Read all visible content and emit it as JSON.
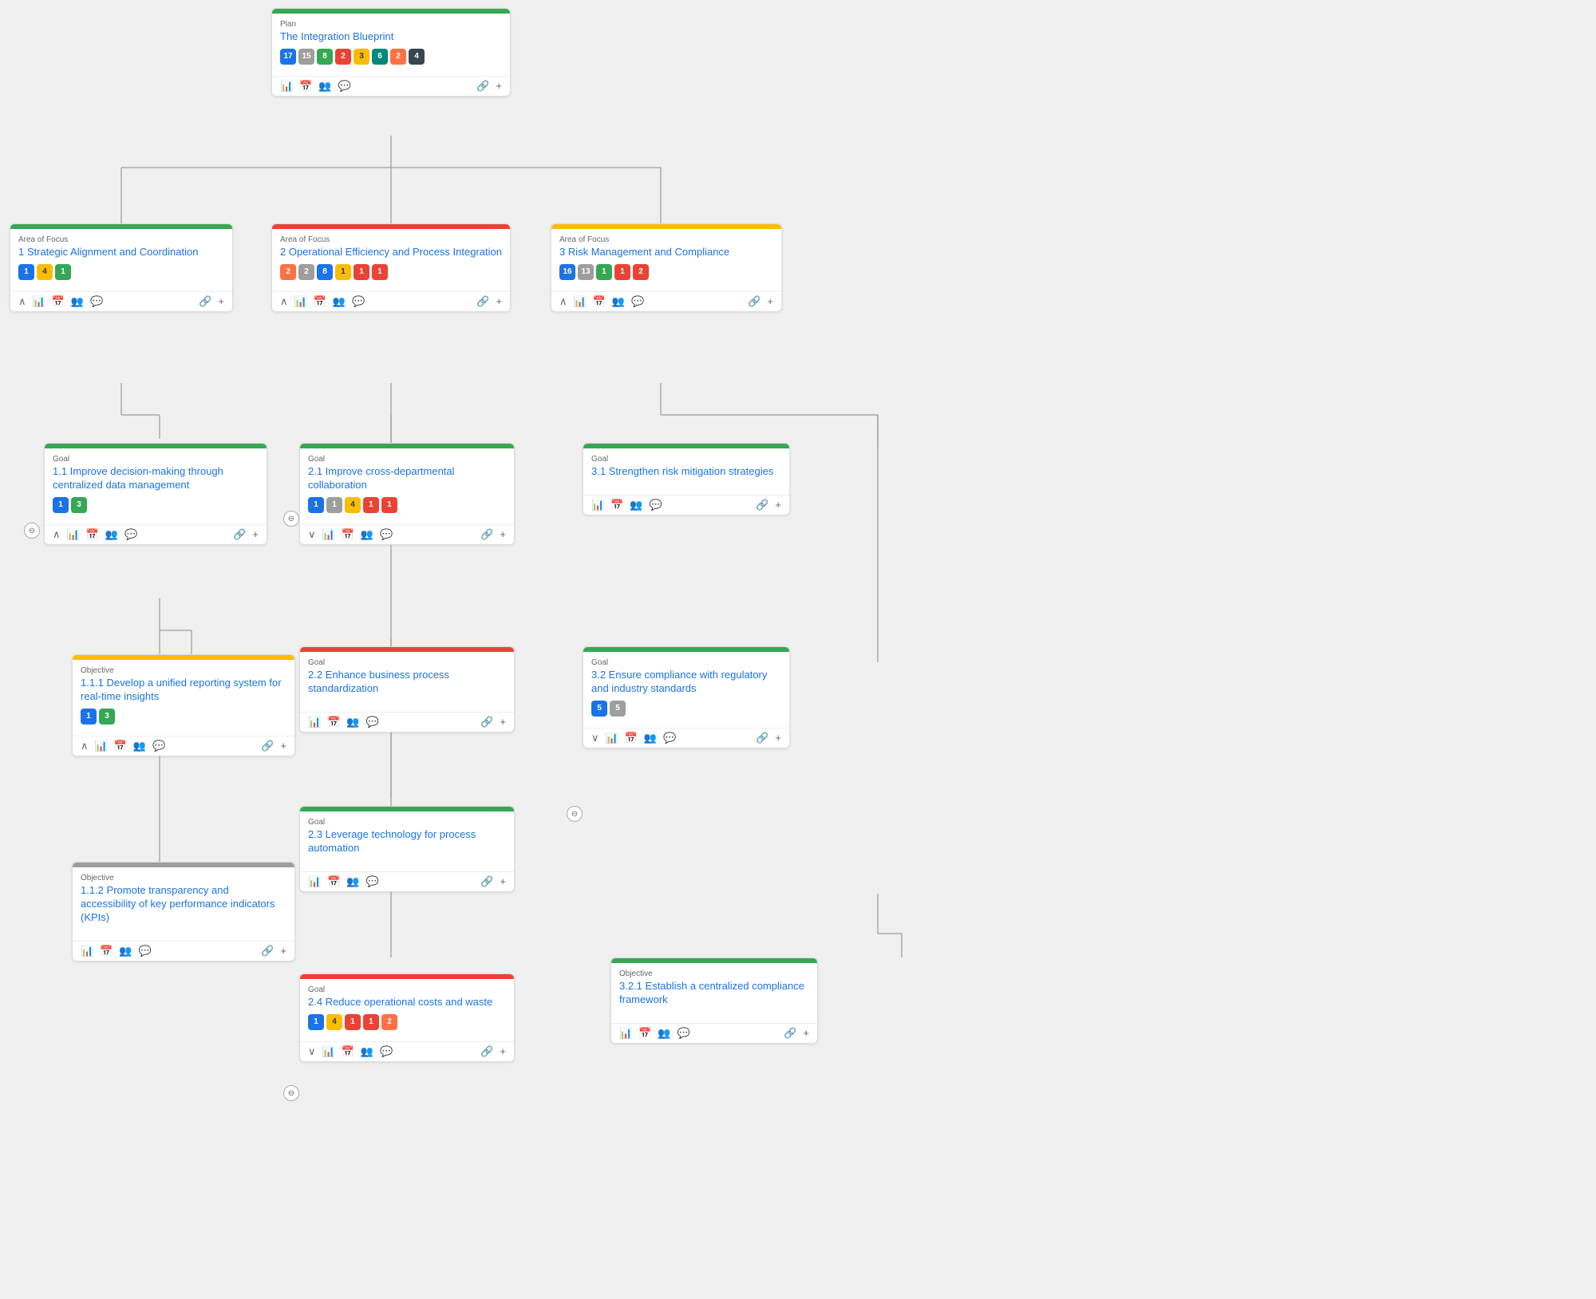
{
  "plan": {
    "type": "Plan",
    "title": "The Integration Blueprint",
    "badges": [
      {
        "value": "17",
        "color": "blue"
      },
      {
        "value": "15",
        "color": "gray"
      },
      {
        "value": "8",
        "color": "green"
      },
      {
        "value": "2",
        "color": "red"
      },
      {
        "value": "3",
        "color": "yellow"
      },
      {
        "value": "6",
        "color": "teal"
      },
      {
        "value": "2",
        "color": "orange"
      },
      {
        "value": "4",
        "color": "dark"
      }
    ],
    "header_color": "green"
  },
  "areas": [
    {
      "type": "Area of Focus",
      "number": "1",
      "title": "Strategic Alignment and Coordination",
      "badges": [
        {
          "value": "1",
          "color": "blue"
        },
        {
          "value": "4",
          "color": "yellow"
        },
        {
          "value": "1",
          "color": "green"
        }
      ],
      "header_color": "green"
    },
    {
      "type": "Area of Focus",
      "number": "2",
      "title": "Operational Efficiency and Process Integration",
      "badges": [
        {
          "value": "2",
          "color": "orange"
        },
        {
          "value": "2",
          "color": "gray"
        },
        {
          "value": "8",
          "color": "blue"
        },
        {
          "value": "1",
          "color": "yellow"
        },
        {
          "value": "1",
          "color": "red"
        },
        {
          "value": "1",
          "color": "red"
        }
      ],
      "header_color": "red"
    },
    {
      "type": "Area of Focus",
      "number": "3",
      "title": "Risk Management and Compliance",
      "badges": [
        {
          "value": "16",
          "color": "blue"
        },
        {
          "value": "13",
          "color": "gray"
        },
        {
          "value": "1",
          "color": "green"
        },
        {
          "value": "1",
          "color": "red"
        },
        {
          "value": "2",
          "color": "red"
        }
      ],
      "header_color": "yellow"
    }
  ],
  "goals_area1": [
    {
      "type": "Goal",
      "number": "1.1",
      "title": "Improve decision-making through centralized data management",
      "badges": [
        {
          "value": "1",
          "color": "blue"
        },
        {
          "value": "3",
          "color": "green"
        }
      ],
      "header_color": "green"
    }
  ],
  "objectives_area1": [
    {
      "type": "Objective",
      "number": "1.1.1",
      "title": "Develop a unified reporting system for real-time insights",
      "badges": [
        {
          "value": "1",
          "color": "blue"
        },
        {
          "value": "3",
          "color": "green"
        }
      ],
      "header_color": "yellow"
    },
    {
      "type": "Objective",
      "number": "1.1.2",
      "title": "Promote transparency and accessibility of key performance indicators (KPIs)",
      "badges": [],
      "header_color": "gray"
    }
  ],
  "goals_area2": [
    {
      "type": "Goal",
      "number": "2.1",
      "title": "Improve cross-departmental collaboration",
      "badges": [
        {
          "value": "1",
          "color": "blue"
        },
        {
          "value": "1",
          "color": "gray"
        },
        {
          "value": "4",
          "color": "yellow"
        },
        {
          "value": "1",
          "color": "red"
        },
        {
          "value": "1",
          "color": "red"
        }
      ],
      "header_color": "green"
    },
    {
      "type": "Goal",
      "number": "2.2",
      "title": "Enhance business process standardization",
      "badges": [],
      "header_color": "red"
    },
    {
      "type": "Goal",
      "number": "2.3",
      "title": "Leverage technology for process automation",
      "badges": [],
      "header_color": "green"
    },
    {
      "type": "Goal",
      "number": "2.4",
      "title": "Reduce operational costs and waste",
      "badges": [
        {
          "value": "1",
          "color": "blue"
        },
        {
          "value": "4",
          "color": "yellow"
        },
        {
          "value": "1",
          "color": "red"
        },
        {
          "value": "1",
          "color": "red"
        },
        {
          "value": "2",
          "color": "orange"
        }
      ],
      "header_color": "red"
    }
  ],
  "goals_area3": [
    {
      "type": "Goal",
      "number": "3.1",
      "title": "Strengthen risk mitigation strategies",
      "badges": [],
      "header_color": "green"
    },
    {
      "type": "Goal",
      "number": "3.2",
      "title": "Ensure compliance with regulatory and industry standards",
      "badges": [
        {
          "value": "5",
          "color": "blue"
        },
        {
          "value": "5",
          "color": "gray"
        }
      ],
      "header_color": "green"
    }
  ],
  "objectives_area3": [
    {
      "type": "Objective",
      "number": "3.2.1",
      "title": "Establish a centralized compliance framework",
      "badges": [],
      "header_color": "green"
    }
  ],
  "icons": {
    "chart": "▦",
    "calendar": "▦",
    "people": "👥",
    "chat": "💬",
    "link": "🔗",
    "plus": "+",
    "chevron_up": "∧",
    "chevron_down": "∨",
    "expand": "⊙",
    "collapse": "⊖"
  }
}
